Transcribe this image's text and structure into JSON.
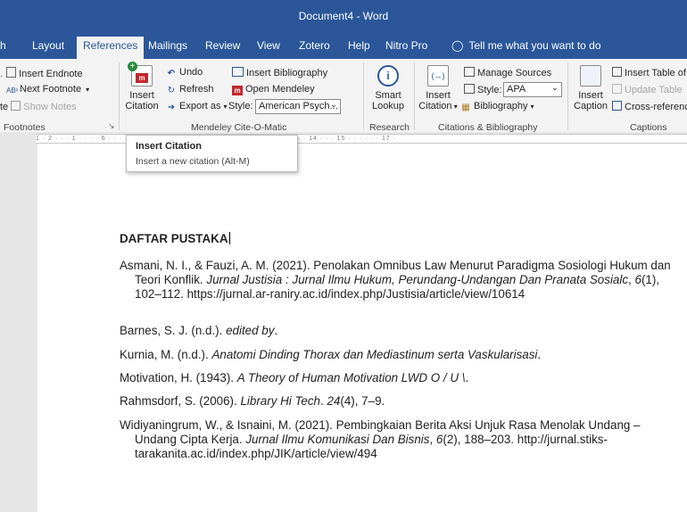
{
  "window": {
    "title": "Document4 - Word"
  },
  "tabs": [
    {
      "label": "h"
    },
    {
      "label": "Layout"
    },
    {
      "label": "References"
    },
    {
      "label": "Mailings"
    },
    {
      "label": "Review"
    },
    {
      "label": "View"
    },
    {
      "label": "Zotero"
    },
    {
      "label": "Help"
    },
    {
      "label": "Nitro Pro"
    },
    {
      "label": "Tell me what you want to do"
    }
  ],
  "ribbon": {
    "footnotes": {
      "insert_endnote": "Insert Endnote",
      "next_footnote": "Next Footnote",
      "show_notes": "Show Notes",
      "cut_left": "te",
      "group_label": "Footnotes"
    },
    "mendeley": {
      "insert_citation_line1": "Insert",
      "insert_citation_line2": "Citation",
      "undo": "Undo",
      "refresh": "Refresh",
      "export_as": "Export as",
      "insert_bibliography": "Insert Bibliography",
      "open_mendeley": "Open Mendeley",
      "style_label": "Style:",
      "style_value": "American Psych...",
      "group_label": "Mendeley Cite-O-Matic"
    },
    "research": {
      "smart_lookup_line1": "Smart",
      "smart_lookup_line2": "Lookup",
      "group_label": "Research"
    },
    "citations": {
      "insert_citation_line1": "Insert",
      "insert_citation_line2": "Citation",
      "manage_sources": "Manage Sources",
      "style_label": "Style:",
      "style_value": "APA",
      "bibliography": "Bibliography",
      "group_label": "Citations & Bibliography"
    },
    "captions": {
      "insert_caption_line1": "Insert",
      "insert_caption_line2": "Caption",
      "insert_table_of_figures": "Insert Table of",
      "update_table": "Update Table",
      "cross_reference": "Cross-referenc",
      "group_label": "Captions"
    }
  },
  "ruler": {
    "text": "1 · 2 · · · 1 · · ·                               · 6 · · · 7 · · · 8 · · · 9 · · · 10 · · · 11 · · · 12 · · · 13 · · · 14 · · · 15 · · ·   · · · 17 ·"
  },
  "tooltip": {
    "title": "Insert Citation",
    "description": "Insert a new citation (Alt-M)"
  },
  "document": {
    "heading": "DAFTAR PUSTAKA",
    "refs": [
      {
        "a": "Asmani, N. I., & Fauzi, A. M. (2021). Penolakan Omnibus Law Menurut Paradigma Sosiologi Hukum dan Teori Konflik. ",
        "b": "Jurnal Justisia : Jurnal Ilmu Hukum, Perundang-Undangan Dan Pranata Sosialc",
        "c": ", ",
        "d": "6",
        "e": "(1), 102–112. https://jurnal.ar-raniry.ac.id/index.php/Justisia/article/view/10614"
      },
      {
        "a": "Barnes, S. J. (n.d.). ",
        "b": "edited by",
        "c": ".",
        "d": "",
        "e": ""
      },
      {
        "a": "Kurnia, M. (n.d.). ",
        "b": "Anatomi Dinding Thorax dan Mediastinum serta Vaskularisasi",
        "c": ".",
        "d": "",
        "e": ""
      },
      {
        "a": "Motivation, H. (1943). ",
        "b": "A Theory of Human Motivation LWD O / U \\",
        "c": ".",
        "d": "",
        "e": ""
      },
      {
        "a": "Rahmsdorf, S. (2006). ",
        "b": "Library Hi Tech",
        "c": ". ",
        "d": "24",
        "e": "(4), 7–9."
      },
      {
        "a": "Widiyaningrum, W., & Isnaini, M. (2021). Pembingkaian Berita Aksi Unjuk Rasa Menolak Undang – Undang Cipta Kerja. ",
        "b": "Jurnal Ilmu Komunikasi Dan Bisnis",
        "c": ", ",
        "d": "6",
        "e": "(2), 188–203. http://jurnal.stiks-tarakanita.ac.id/index.php/JIK/article/view/494"
      }
    ]
  },
  "colors": {
    "word_blue": "#2b579a",
    "ribbon_bg": "#f3f3f3",
    "mendeley_red": "#c4262e"
  }
}
